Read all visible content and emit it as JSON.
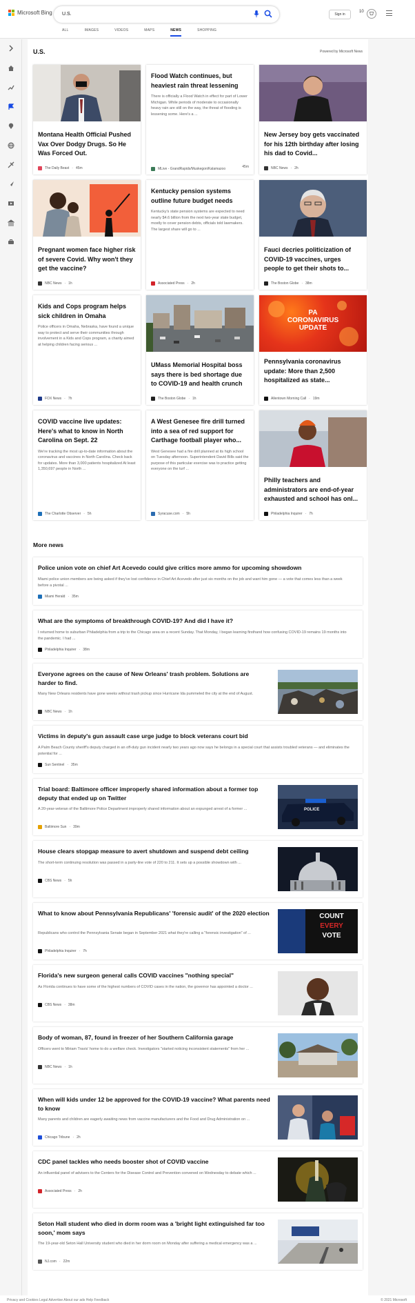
{
  "header": {
    "brand": "Microsoft Bing",
    "query": "U.S.",
    "signin": "Sign in",
    "rewards_count": "10",
    "brand_colors": [
      "#f25022",
      "#7fba00",
      "#00a4ef",
      "#ffb900"
    ],
    "accent": "#174ae4"
  },
  "tabs": [
    "ALL",
    "IMAGES",
    "VIDEOS",
    "MAPS",
    "NEWS",
    "SHOPPING"
  ],
  "active_tab": "NEWS",
  "rail_icons": [
    "expand-icon",
    "home-icon",
    "trending-icon",
    "flag-icon",
    "location-icon",
    "globe-icon",
    "sports-icon",
    "science-icon",
    "entertainment-icon",
    "politics-icon",
    "business-icon"
  ],
  "page": {
    "title": "U.S.",
    "powered": "Powered by Microsoft News",
    "more_news": "More news"
  },
  "cards": [
    {
      "title": "Montana Health Official Pushed Vax Over Dodgy Drugs. So He Was Forced Out.",
      "snippet": "",
      "source": "The Daily Beast",
      "time": "45m",
      "source_color": "#e0455a"
    },
    {
      "title": "Flood Watch continues, but heaviest rain threat lessening",
      "snippet": "There is officially a Flood Watch in effect for part of Lower Michigan. While periods of moderate to occasionally heavy rain are still on the way, the threat of flooding is lessening some. Here's a ...",
      "source": "MLive - GrandRapids/Muskegon/Kalamazoo",
      "time": "45m",
      "source_color": "#3b7a57"
    },
    {
      "title": "New Jersey boy gets vaccinated for his 12th birthday after losing his dad to Covid...",
      "snippet": "",
      "source": "NBC News",
      "time": "2h",
      "source_color": "#333333"
    },
    {
      "title": "Pregnant women face higher risk of severe Covid. Why won't they get the vaccine?",
      "snippet": "",
      "source": "NBC News",
      "time": "1h",
      "source_color": "#333333"
    },
    {
      "title": "Kentucky pension systems outline future budget needs",
      "snippet": "Kentucky's state pension systems are expected to need nearly $4.6 billion from the next two-year state budget, mostly to cover pension debts, officials told lawmakers. The largest share will go to ...",
      "source": "Associated Press",
      "time": "2h",
      "source_color": "#d2232a"
    },
    {
      "title": "Fauci decries politicization of COVID-19 vaccines, urges people to get their shots to...",
      "snippet": "",
      "source": "The Boston Globe",
      "time": "38m",
      "source_color": "#222222"
    },
    {
      "title": "Kids and Cops program helps sick children in Omaha",
      "snippet": "Police officers in Omaha, Nebraska, have found a unique way to protect and serve their communities through involvement in a Kids and Cops program, a charity aimed at helping children facing serious ...",
      "source": "FOX News",
      "time": "7h",
      "source_color": "#1e3a8a"
    },
    {
      "title": "UMass Memorial Hospital boss says there is bed shortage due to COVID-19 and health crunch",
      "snippet": "",
      "source": "The Boston Globe",
      "time": "1h",
      "source_color": "#222222"
    },
    {
      "title": "Pennsylvania coronavirus update: More than 2,500 hospitalized as state...",
      "snippet": "",
      "source": "Allentown Morning Call",
      "time": "19m",
      "source_color": "#111111"
    },
    {
      "title": "COVID vaccine live updates: Here's what to know in North Carolina on Sept. 22",
      "snippet": "We're tracking the most up-to-date information about the coronavirus and vaccines in North Carolina. Check back for updates. More than 3,000 patients hospitalized At least 1,350,697 people in North ...",
      "source": "The Charlotte Observer",
      "time": "5h",
      "source_color": "#1d6fb8"
    },
    {
      "title": "A West Genesee fire drill turned into a sea of red support for Carthage football player who...",
      "snippet": "West Genesee had a fire drill planned at its high school on Tuesday afternoon. Superintendent David Bills said the purpose of this particular exercise was to practice getting everyone on the turf ...",
      "source": "Syracuse.com",
      "time": "5h",
      "source_color": "#2b6cb0"
    },
    {
      "title": "Philly teachers and administrators are end-of-year exhausted and school has onl...",
      "snippet": "",
      "source": "Philadelphia Inquirer",
      "time": "7h",
      "source_color": "#111111"
    }
  ],
  "image_overlay": {
    "line1": "PA",
    "line2": "CORONAVIRUS",
    "line3": "UPDATE"
  },
  "thumb_texts": {
    "vote1": "COUNT",
    "vote2": "EVERY",
    "vote3": "VOTE",
    "police": "POLICE"
  },
  "more": [
    {
      "title": "Police union vote on chief Art Acevedo could give critics more ammo for upcoming showdown",
      "snippet": "Miami police union members are being asked if they've lost confidence in Chief Art Acevedo after just six months on the job and want him gone — a vote that comes less than a week before a pivotal ...",
      "source": "Miami Herald",
      "time": "35m",
      "source_color": "#1d6fb8",
      "image": false
    },
    {
      "title": "What are the symptoms of breakthrough COVID-19? And did I have it?",
      "snippet": "I returned home to suburban Philadelphia from a trip to the Chicago area on a recent Sunday. That Monday, I began learning firsthand how confusing COVID-19 remains 19 months into the pandemic. I had ...",
      "source": "Philadelphia Inquirer",
      "time": "38m",
      "source_color": "#111111",
      "image": false
    },
    {
      "title": "Everyone agrees on the cause of New Orleans' trash problem. Solutions are harder to find.",
      "snippet": "Many New Orleans residents have gone weeks without trash pickup since Hurricane Ida pummeled the city at the end of August.",
      "source": "NBC News",
      "time": "1h",
      "source_color": "#333333",
      "image": true
    },
    {
      "title": "Victims in deputy's gun assault case urge judge to block veterans court bid",
      "snippet": "A Palm Beach County sheriff's deputy charged in an off-duty gun incident nearly two years ago now says he belongs in a special court that assists troubled veterans — and eliminates the potential for ...",
      "source": "Sun Sentinel",
      "time": "35m",
      "source_color": "#111111",
      "image": false
    },
    {
      "title": "Trial board: Baltimore officer improperly shared information about a former top deputy that ended up on Twitter",
      "snippet": "A 20-year-veteran of the Baltimore Police Department improperly shared information about an expunged arrest of a former ...",
      "source": "Baltimore Sun",
      "time": "39m",
      "source_color": "#e5a100",
      "image": true
    },
    {
      "title": "House clears stopgap measure to avert shutdown and suspend debt ceiling",
      "snippet": "The short-term continuing resolution was passed in a party-line vote of 220 to 211. It sets up a possible showdown with ...",
      "source": "CBS News",
      "time": "5h",
      "source_color": "#111111",
      "image": true
    },
    {
      "title": "What to know about Pennsylvania Republicans' 'forensic audit' of the 2020 election",
      "snippet": "Republicans who control the Pennsylvania Senate began in September 2021 what they're calling a \"forensic investigation\" of ...",
      "source": "Philadelphia Inquirer",
      "time": "7h",
      "source_color": "#111111",
      "image": true
    },
    {
      "title": "Florida's new surgeon general calls COVID vaccines \"nothing special\"",
      "snippet": "As Florida continues to have some of the highest numbers of COVID cases in the nation, the governor has appointed a doctor ...",
      "source": "CBS News",
      "time": "38m",
      "source_color": "#111111",
      "image": true
    },
    {
      "title": "Body of woman, 87, found in freezer of her Southern California garage",
      "snippet": "Officers went to Miriam Travis' home to do a welfare check. Investigators \"started noticing inconsistent statements\" from her ...",
      "source": "NBC News",
      "time": "1h",
      "source_color": "#333333",
      "image": true
    },
    {
      "title": "When will kids under 12 be approved for the COVID-19 vaccine? What parents need to know",
      "snippet": "Many parents and children are eagerly awaiting news from vaccine manufacturers and the Food and Drug Administration on ...",
      "source": "Chicago Tribune",
      "time": "2h",
      "source_color": "#1d4ed8",
      "image": true
    },
    {
      "title": "CDC panel tackles who needs booster shot of COVID vaccine",
      "snippet": "An influential panel of advisers to the Centers for the Disease Control and Prevention convened on Wednesday to debate which ...",
      "source": "Associated Press",
      "time": "2h",
      "source_color": "#d2232a",
      "image": true
    },
    {
      "title": "Seton Hall student who died in dorm room was a 'bright light extinguished far too soon,' mom says",
      "snippet": "The 19-year-old Seton Hall University student who died in her dorm room on Monday after suffering a medical emergency was a ...",
      "source": "NJ.com",
      "time": "22m",
      "source_color": "#555555",
      "image": true
    }
  ],
  "footer": {
    "text": "Privacy and Cookies   Legal   Advertise   About our ads   Help   Feedback",
    "copyright": "© 2021 Microsoft"
  }
}
